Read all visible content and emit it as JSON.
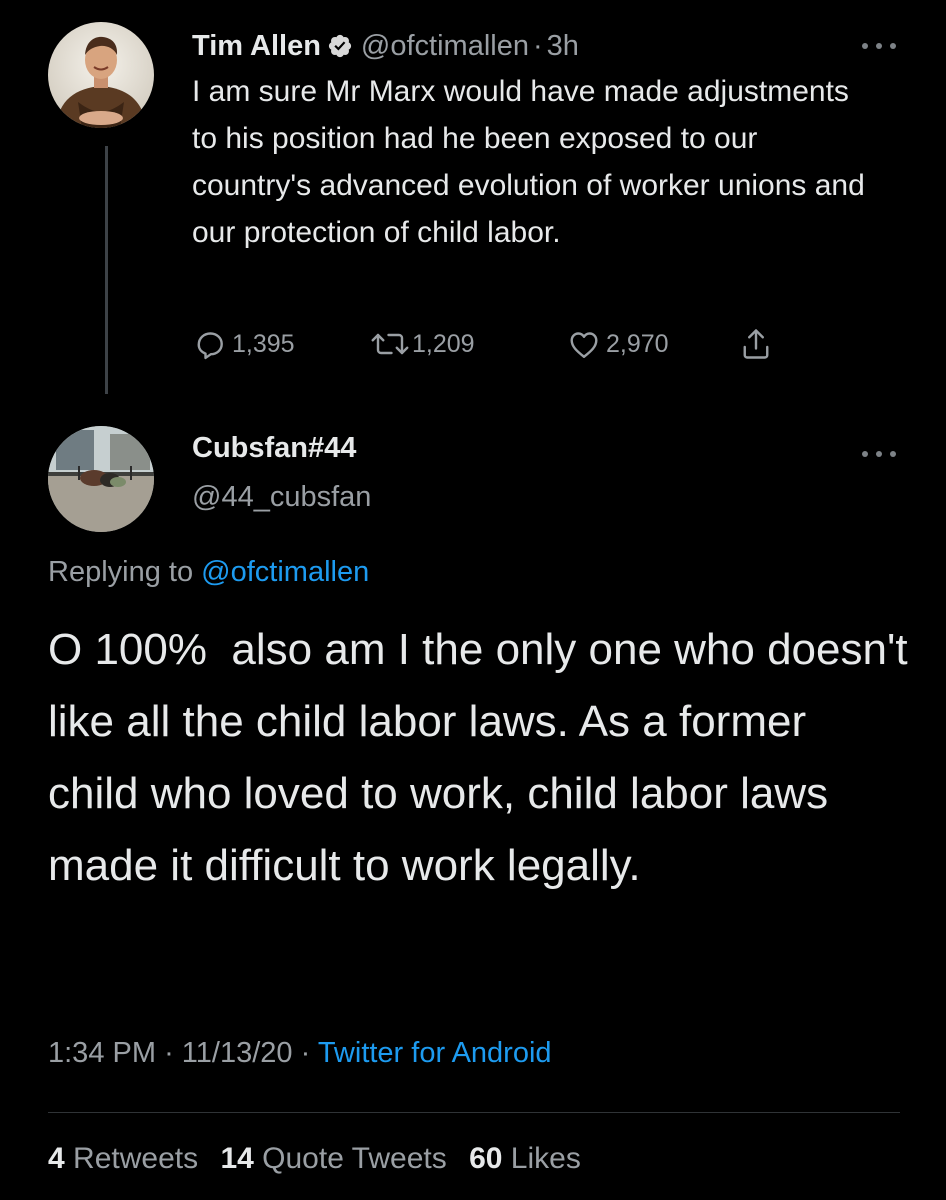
{
  "colors": {
    "background": "#000000",
    "text_primary": "#e7e9ea",
    "text_secondary": "#9a9fa4",
    "link": "#1d9bf0",
    "verified": "#d9d9d9",
    "divider": "#2f3336"
  },
  "parent_tweet": {
    "display_name": "Tim Allen",
    "verified_icon": "verified-badge-icon",
    "handle": "@ofctimallen",
    "separator": "·",
    "time": "3h",
    "text": "I am sure Mr Marx would have made adjustments to his position had he been exposed to our country's advanced evolution of worker unions and our protection of child labor.",
    "actions": {
      "reply_count": "1,395",
      "retweet_count": "1,209",
      "like_count": "2,970"
    },
    "icons": [
      "reply-icon",
      "retweet-icon",
      "like-icon",
      "share-icon",
      "more-options-icon"
    ]
  },
  "reply_tweet": {
    "display_name": "Cubsfan#44",
    "handle": "@44_cubsfan",
    "replying_to_label": "Replying to",
    "replying_to_handle": "@ofctimallen",
    "text": "O 100%  also am I the only one who doesn't like all the child labor laws. As a former child who loved to work, child labor laws made it difficult to work legally.",
    "time": "1:34 PM",
    "separator": "·",
    "date": "11/13/20",
    "source": "Twitter for Android",
    "stats": {
      "retweets_count": "4",
      "retweets_label": "Retweets",
      "quote_tweets_count": "14",
      "quote_tweets_label": "Quote Tweets",
      "likes_count": "60",
      "likes_label": "Likes"
    }
  }
}
